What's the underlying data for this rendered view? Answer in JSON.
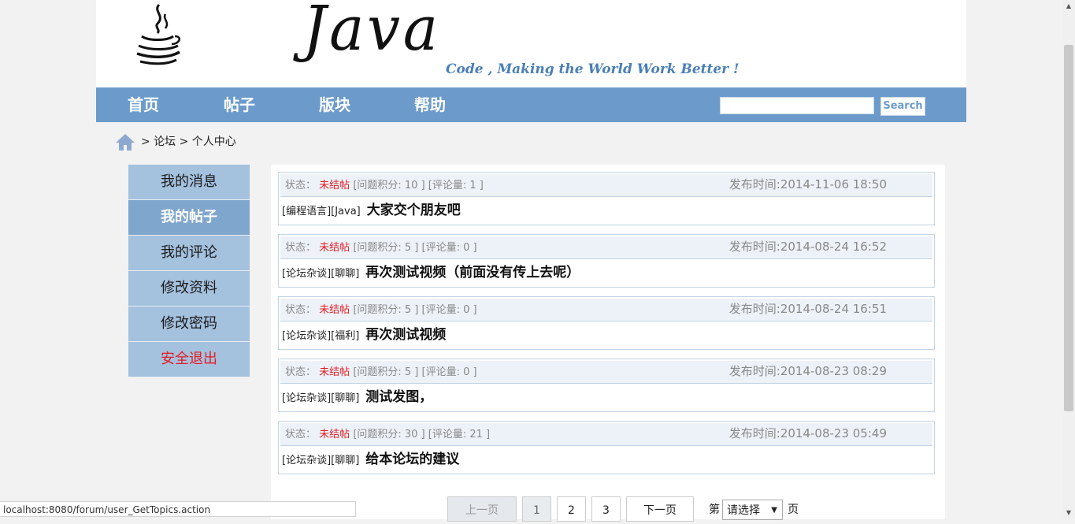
{
  "header": {
    "logo_text": "Java",
    "slogan": "Code , Making the World Work Better !"
  },
  "nav": {
    "items": [
      {
        "label": "首页"
      },
      {
        "label": "帖子"
      },
      {
        "label": "版块"
      },
      {
        "label": "帮助"
      }
    ],
    "search": {
      "placeholder": "",
      "button_label": "Search"
    }
  },
  "breadcrumb": {
    "text": "> 论坛 > 个人中心"
  },
  "sidebar": {
    "items": [
      {
        "label": "我的消息"
      },
      {
        "label": "我的帖子"
      },
      {
        "label": "我的评论"
      },
      {
        "label": "修改资料"
      },
      {
        "label": "修改密码"
      },
      {
        "label": "安全退出"
      }
    ]
  },
  "topics": [
    {
      "status_label": "状态：",
      "status": "未结帖",
      "stats": "[问题积分: 10 ] [评论量: 1 ]",
      "time": "发布时间:2014-11-06 18:50",
      "category": "[编程语言][Java]",
      "title": "大家交个朋友吧"
    },
    {
      "status_label": "状态：",
      "status": "未结帖",
      "stats": "[问题积分: 5 ] [评论量: 0 ]",
      "time": "发布时间:2014-08-24 16:52",
      "category": "[论坛杂谈][聊聊]",
      "title": "再次测试视频（前面没有传上去呢）"
    },
    {
      "status_label": "状态：",
      "status": "未结帖",
      "stats": "[问题积分: 5 ] [评论量: 0 ]",
      "time": "发布时间:2014-08-24 16:51",
      "category": "[论坛杂谈][福利]",
      "title": "再次测试视频"
    },
    {
      "status_label": "状态：",
      "status": "未结帖",
      "stats": "[问题积分: 5 ] [评论量: 0 ]",
      "time": "发布时间:2014-08-23 08:29",
      "category": "[论坛杂谈][聊聊]",
      "title": "测试发图，"
    },
    {
      "status_label": "状态：",
      "status": "未结帖",
      "stats": "[问题积分: 30 ] [评论量: 21 ]",
      "time": "发布时间:2014-08-23 05:49",
      "category": "[论坛杂谈][聊聊]",
      "title": "给本论坛的建议"
    }
  ],
  "pager": {
    "prev": "上一页",
    "pages": [
      "1",
      "2",
      "3"
    ],
    "next": "下一页",
    "goto_prefix": "第",
    "select_value": "请选择",
    "goto_suffix": "页"
  },
  "status_bar": {
    "url": "localhost:8080/forum/user_GetTopics.action"
  },
  "colors": {
    "nav_bg": "#6c9bcb",
    "sidebar_bg": "#a4c1de",
    "sidebar_active": "#7fa6cc",
    "accent_red": "#e51c23"
  }
}
